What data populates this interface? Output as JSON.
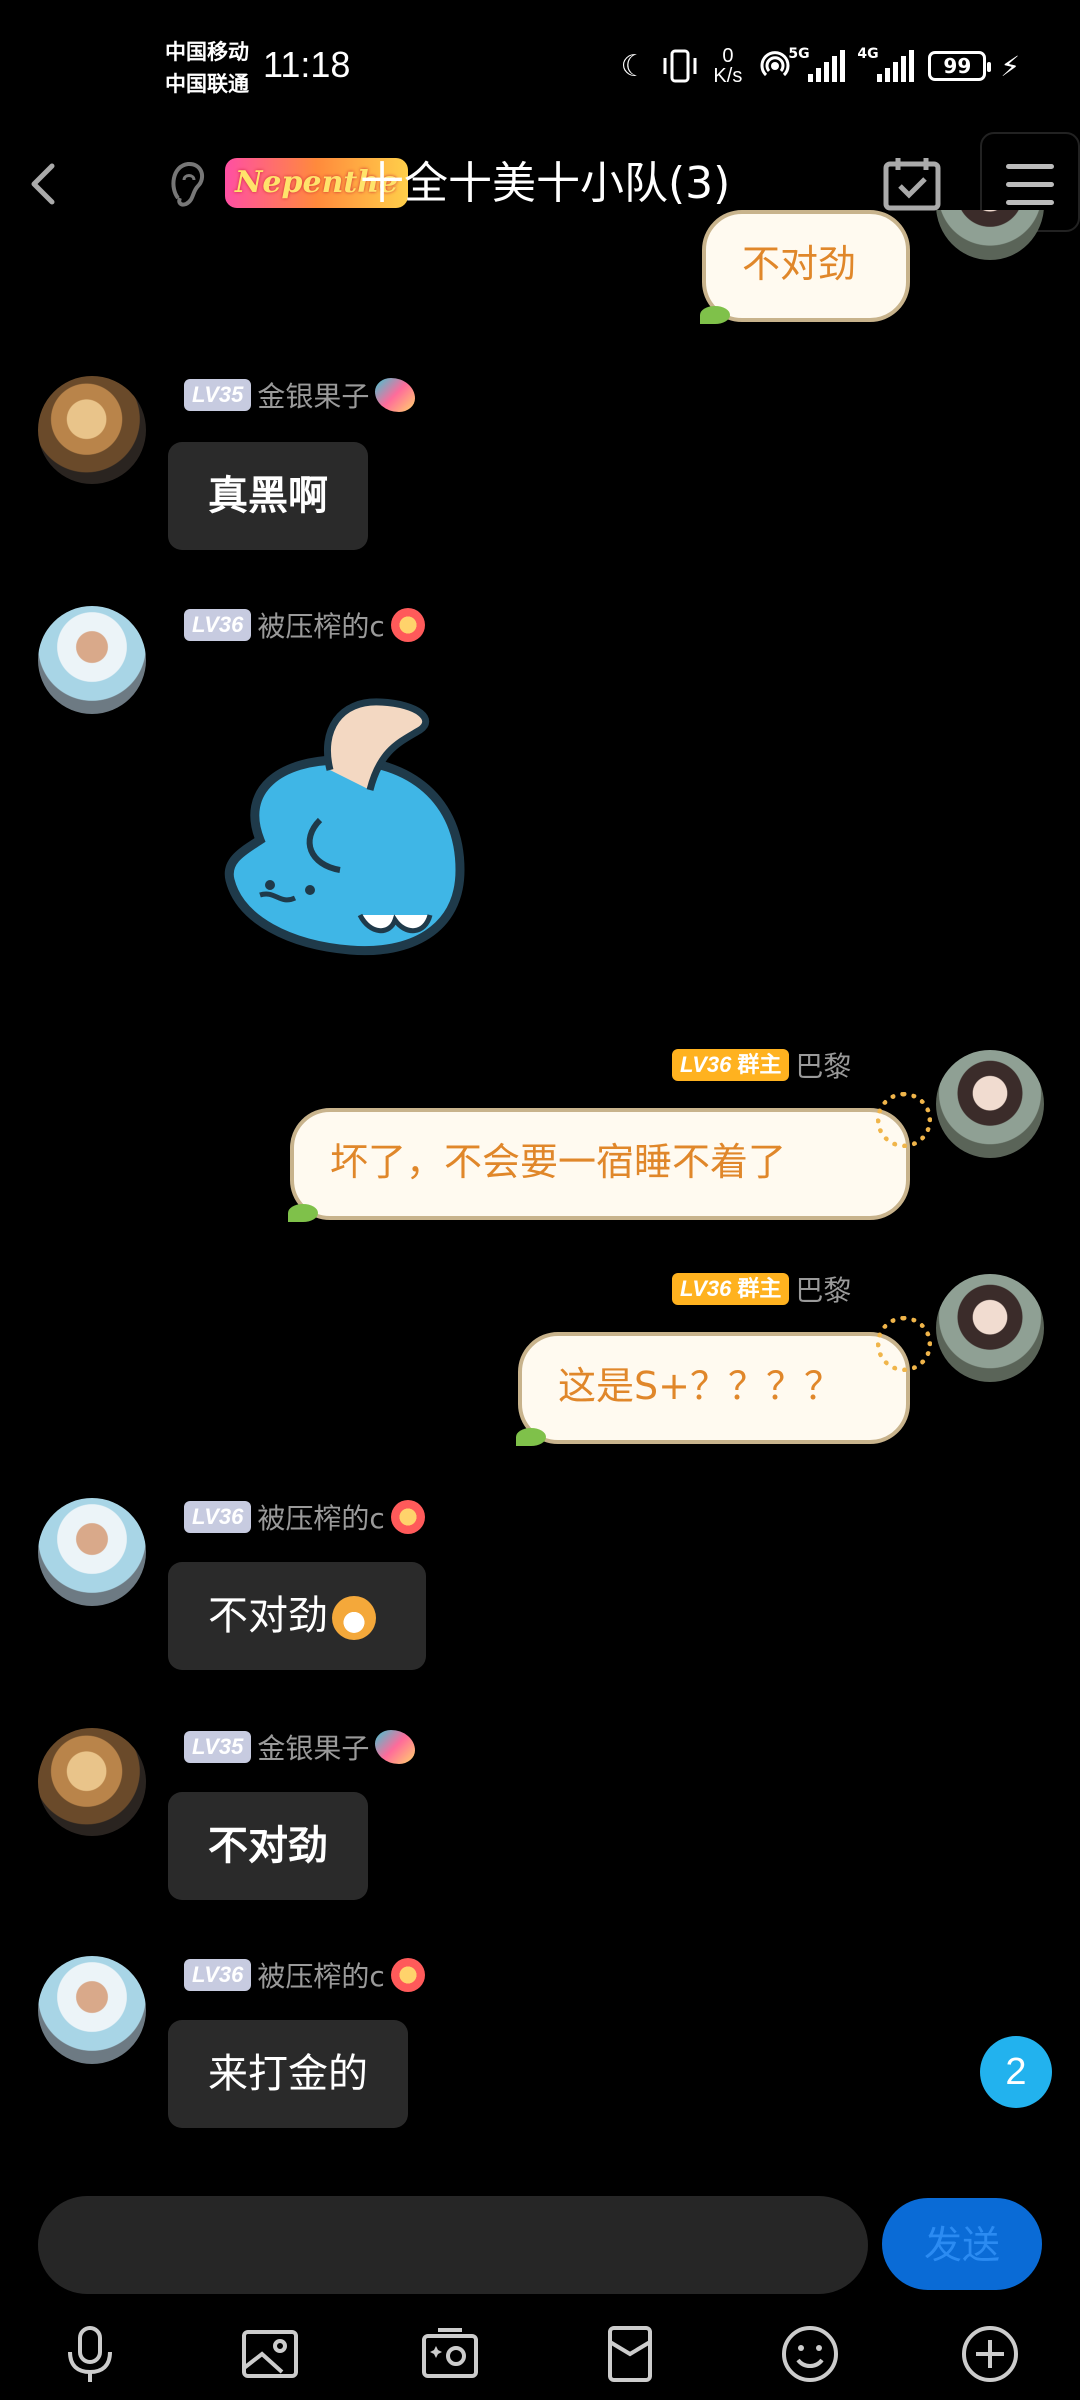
{
  "status_bar": {
    "carrier_1": "中国移动",
    "carrier_2": "中国联通",
    "time": "11:18",
    "net_speed_value": "0",
    "net_speed_unit": "K/s",
    "signal_1_label": "5G",
    "signal_2_label": "4G",
    "battery": "99"
  },
  "header": {
    "badge": "Nepenthe",
    "title": "十全十美十小队(3)"
  },
  "messages": [
    {
      "text": "不对劲"
    },
    {
      "level": "LV35",
      "sender": "金银果子",
      "text": "真黑啊"
    },
    {
      "level": "LV36",
      "sender": "被压榨的c",
      "sticker": "blue-cat-sticker"
    },
    {
      "level": "LV36",
      "role": "群主",
      "sender": "巴黎",
      "text": "坏了，不会要一宿睡不着了"
    },
    {
      "level": "LV36",
      "role": "群主",
      "sender": "巴黎",
      "text": "这是S+？？？？"
    },
    {
      "level": "LV36",
      "sender": "被压榨的c",
      "text": "不对劲"
    },
    {
      "level": "LV35",
      "sender": "金银果子",
      "text": "不对劲"
    },
    {
      "level": "LV36",
      "sender": "被压榨的c",
      "text": "来打金的"
    }
  ],
  "unread_count": "2",
  "composer": {
    "placeholder": "",
    "send_label": "发送"
  },
  "colors": {
    "background": "#000000",
    "bubble_other": "#2a2a2a",
    "bubble_self_bg": "#fffaf0",
    "bubble_self_text": "#e0872a",
    "owner_badge": "#ffb21f",
    "send_button": "#0a6bd6",
    "unread_badge": "#22b2ee"
  },
  "toolbar_icons": [
    "microphone-icon",
    "image-icon",
    "camera-icon",
    "red-packet-icon",
    "emoji-icon",
    "plus-icon"
  ]
}
